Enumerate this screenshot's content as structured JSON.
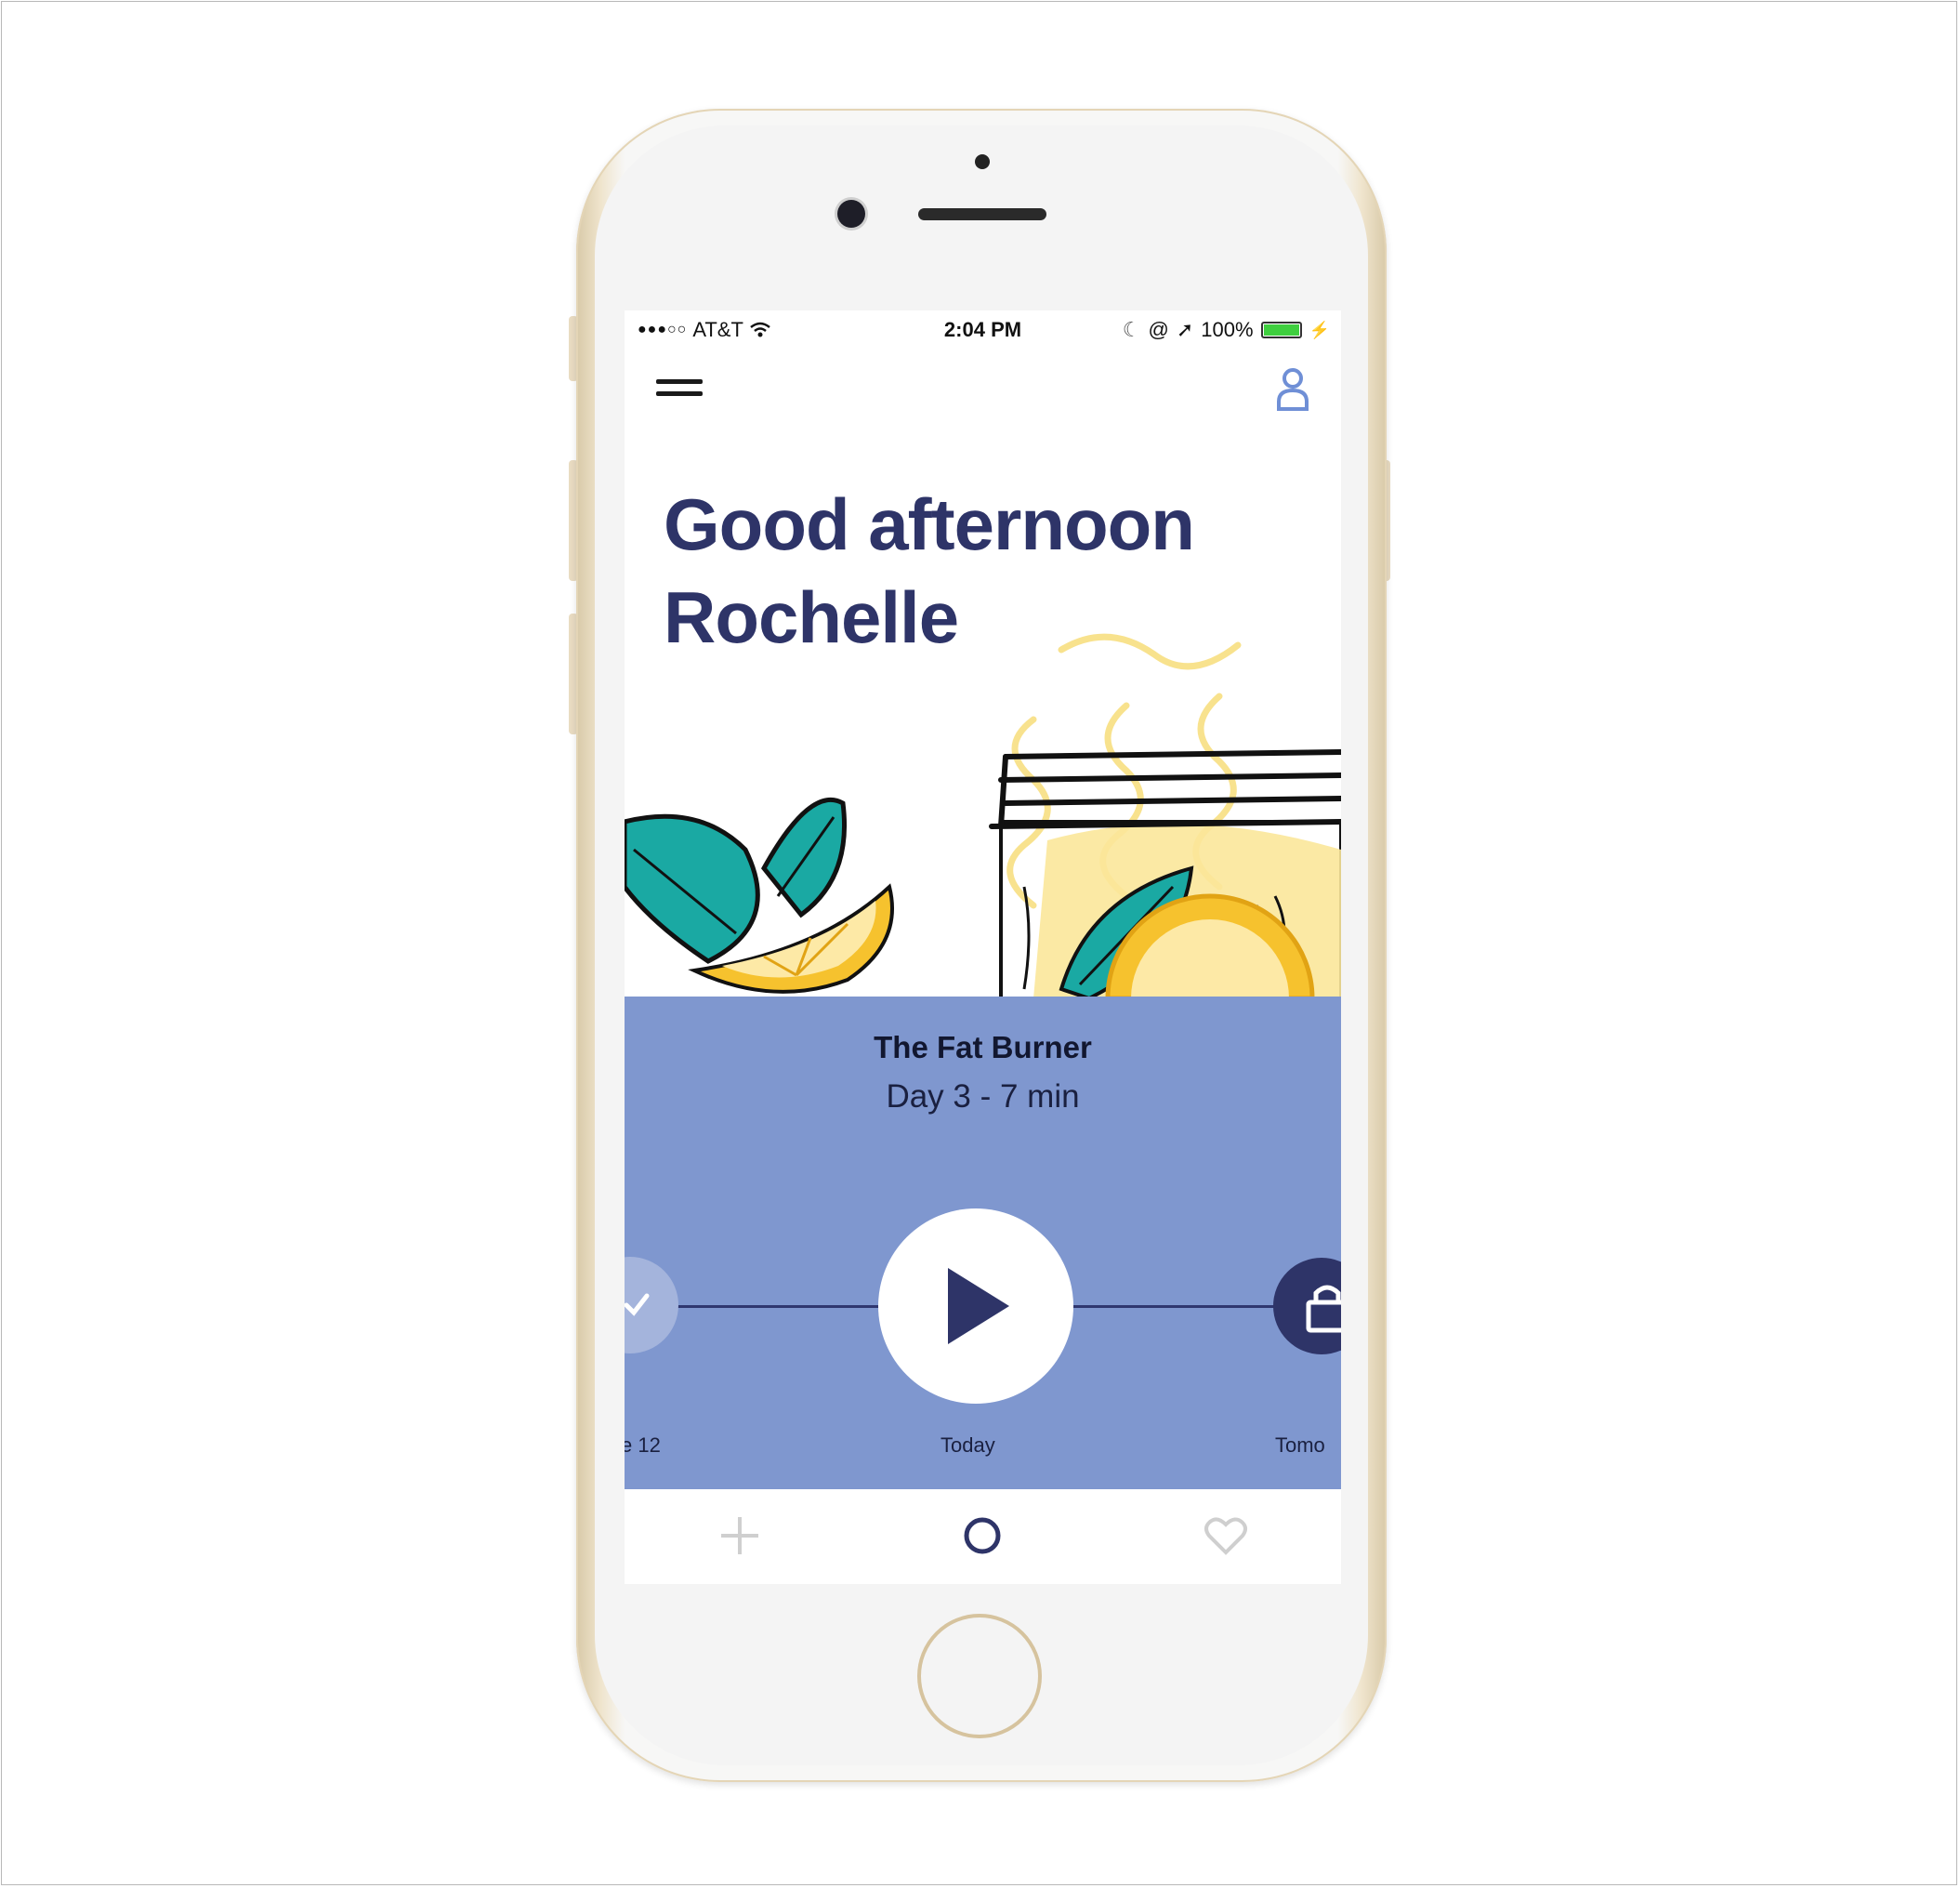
{
  "status_bar": {
    "carrier": "AT&T",
    "time": "2:04 PM",
    "battery": "100%"
  },
  "greeting": {
    "line1": "Good afternoon",
    "line2": "Rochelle"
  },
  "program": {
    "title": "The Fat Burner",
    "subtitle": "Day 3 - 7 min"
  },
  "timeline": {
    "prev_label": "e 12",
    "today_label": "Today",
    "next_label": "Tomo"
  },
  "icons": {
    "menu": "hamburger-icon",
    "profile": "person-icon",
    "play": "play-icon",
    "prev_done": "checkmark-icon",
    "next_locked": "lock-icon",
    "tab_add": "plus-icon",
    "tab_home": "circle-icon",
    "tab_favorites": "heart-icon"
  },
  "colors": {
    "accent_navy": "#2e3468",
    "player_blue": "#7f97cf",
    "profile_blue": "#6f8fd6",
    "teal_leaf": "#1aa9a3",
    "lemon_yellow": "#f6c22e"
  }
}
